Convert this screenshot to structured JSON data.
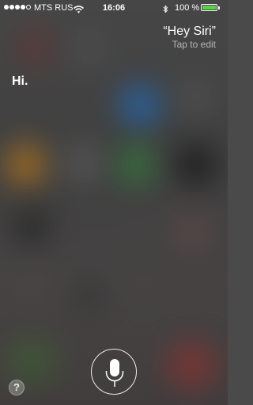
{
  "status_bar": {
    "carrier": "MTS RUS",
    "time": "16:06",
    "battery_percent_label": "100 %",
    "battery_level": 1.0,
    "battery_color": "#5ad246",
    "signal_bars": 4,
    "icons": [
      "signal-dots-icon",
      "wifi-icon",
      "bluetooth-icon",
      "battery-icon"
    ]
  },
  "siri": {
    "user_utterance": "“Hey Siri”",
    "tap_to_edit": "Tap to edit",
    "response": "Hi."
  },
  "controls": {
    "help_label": "?",
    "mic_icon": "microphone-icon"
  }
}
